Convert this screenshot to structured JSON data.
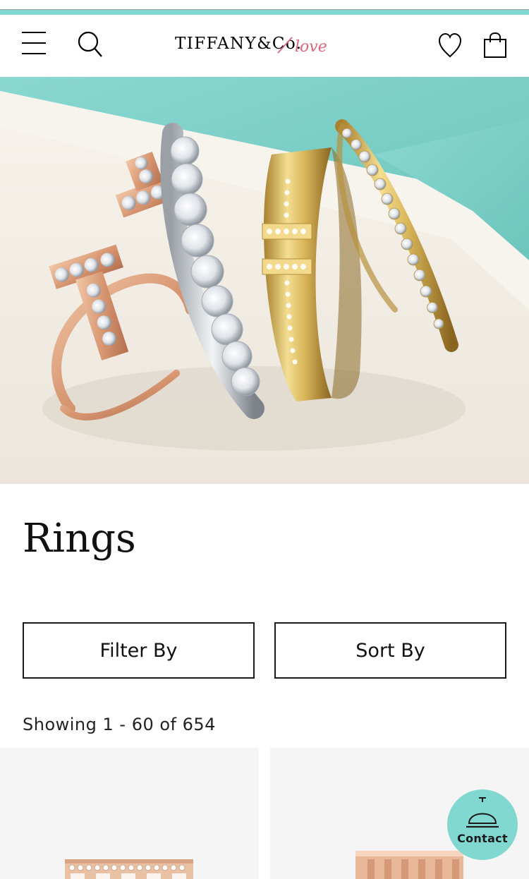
{
  "header": {
    "logo_text": "TIFFANY&Co.",
    "logo_script": "love",
    "icons": {
      "menu": "hamburger-menu-icon",
      "search": "search-icon",
      "wishlist": "heart-icon",
      "bag": "shopping-bag-icon"
    }
  },
  "hero": {
    "subject": "rings-photo"
  },
  "page": {
    "title": "Rings",
    "filter_label": "Filter By",
    "sort_label": "Sort By",
    "results_text": "Showing 1 - 60 of 654"
  },
  "contact": {
    "label": "Contact",
    "icon": "service-bell-icon"
  },
  "colors": {
    "brand_blue": "#81d8d0",
    "text": "#111111",
    "love_pink": "#d9667a"
  }
}
